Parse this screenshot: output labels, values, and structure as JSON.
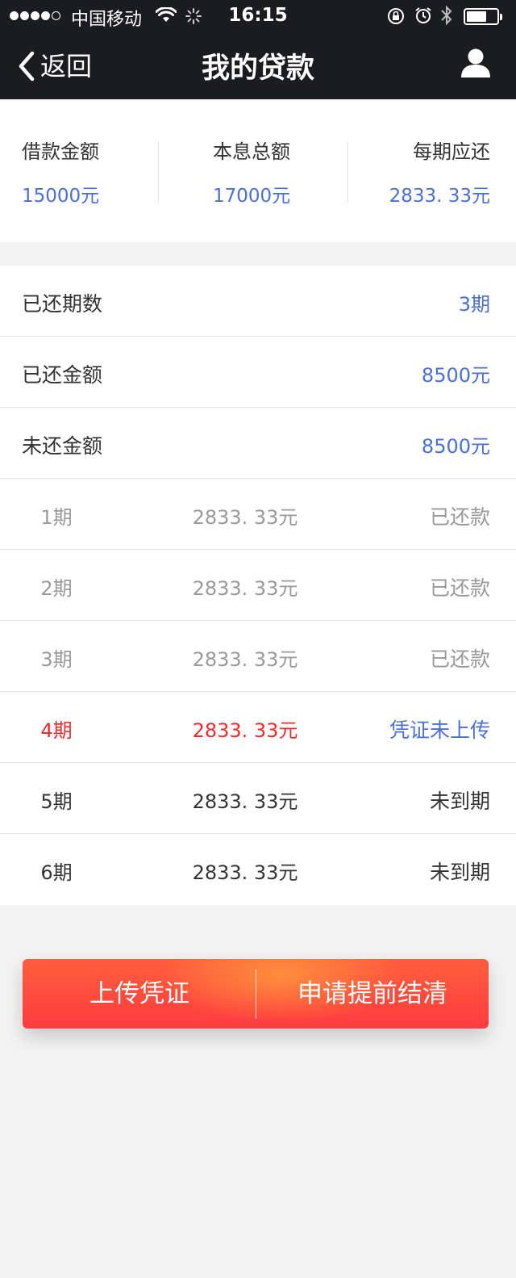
{
  "status_bar": {
    "carrier": "中国移动",
    "time": "16:15"
  },
  "nav": {
    "back_label": "返回",
    "title": "我的贷款"
  },
  "summary": [
    {
      "label": "借款金额",
      "value": "15000元"
    },
    {
      "label": "本息总额",
      "value": "17000元"
    },
    {
      "label": "每期应还",
      "value": "2833. 33元"
    }
  ],
  "stats": [
    {
      "label": "已还期数",
      "value": "3期"
    },
    {
      "label": "已还金额",
      "value": "8500元"
    },
    {
      "label": "未还金额",
      "value": "8500元"
    }
  ],
  "periods": [
    {
      "period": "1期",
      "amount": "2833. 33元",
      "status": "已还款"
    },
    {
      "period": "2期",
      "amount": "2833. 33元",
      "status": "已还款"
    },
    {
      "period": "3期",
      "amount": "2833. 33元",
      "status": "已还款"
    },
    {
      "period": "4期",
      "amount": "2833. 33元",
      "status": "凭证未上传"
    },
    {
      "period": "5期",
      "amount": "2833. 33元",
      "status": "未到期"
    },
    {
      "period": "6期",
      "amount": "2833. 33元",
      "status": "未到期"
    }
  ],
  "actions": {
    "upload_label": "上传凭证",
    "settle_label": "申请提前结清"
  },
  "colors": {
    "accent_blue": "#4a6fd6",
    "overdue_red": "#f02b2b",
    "button_red": "#ff3b3f"
  }
}
